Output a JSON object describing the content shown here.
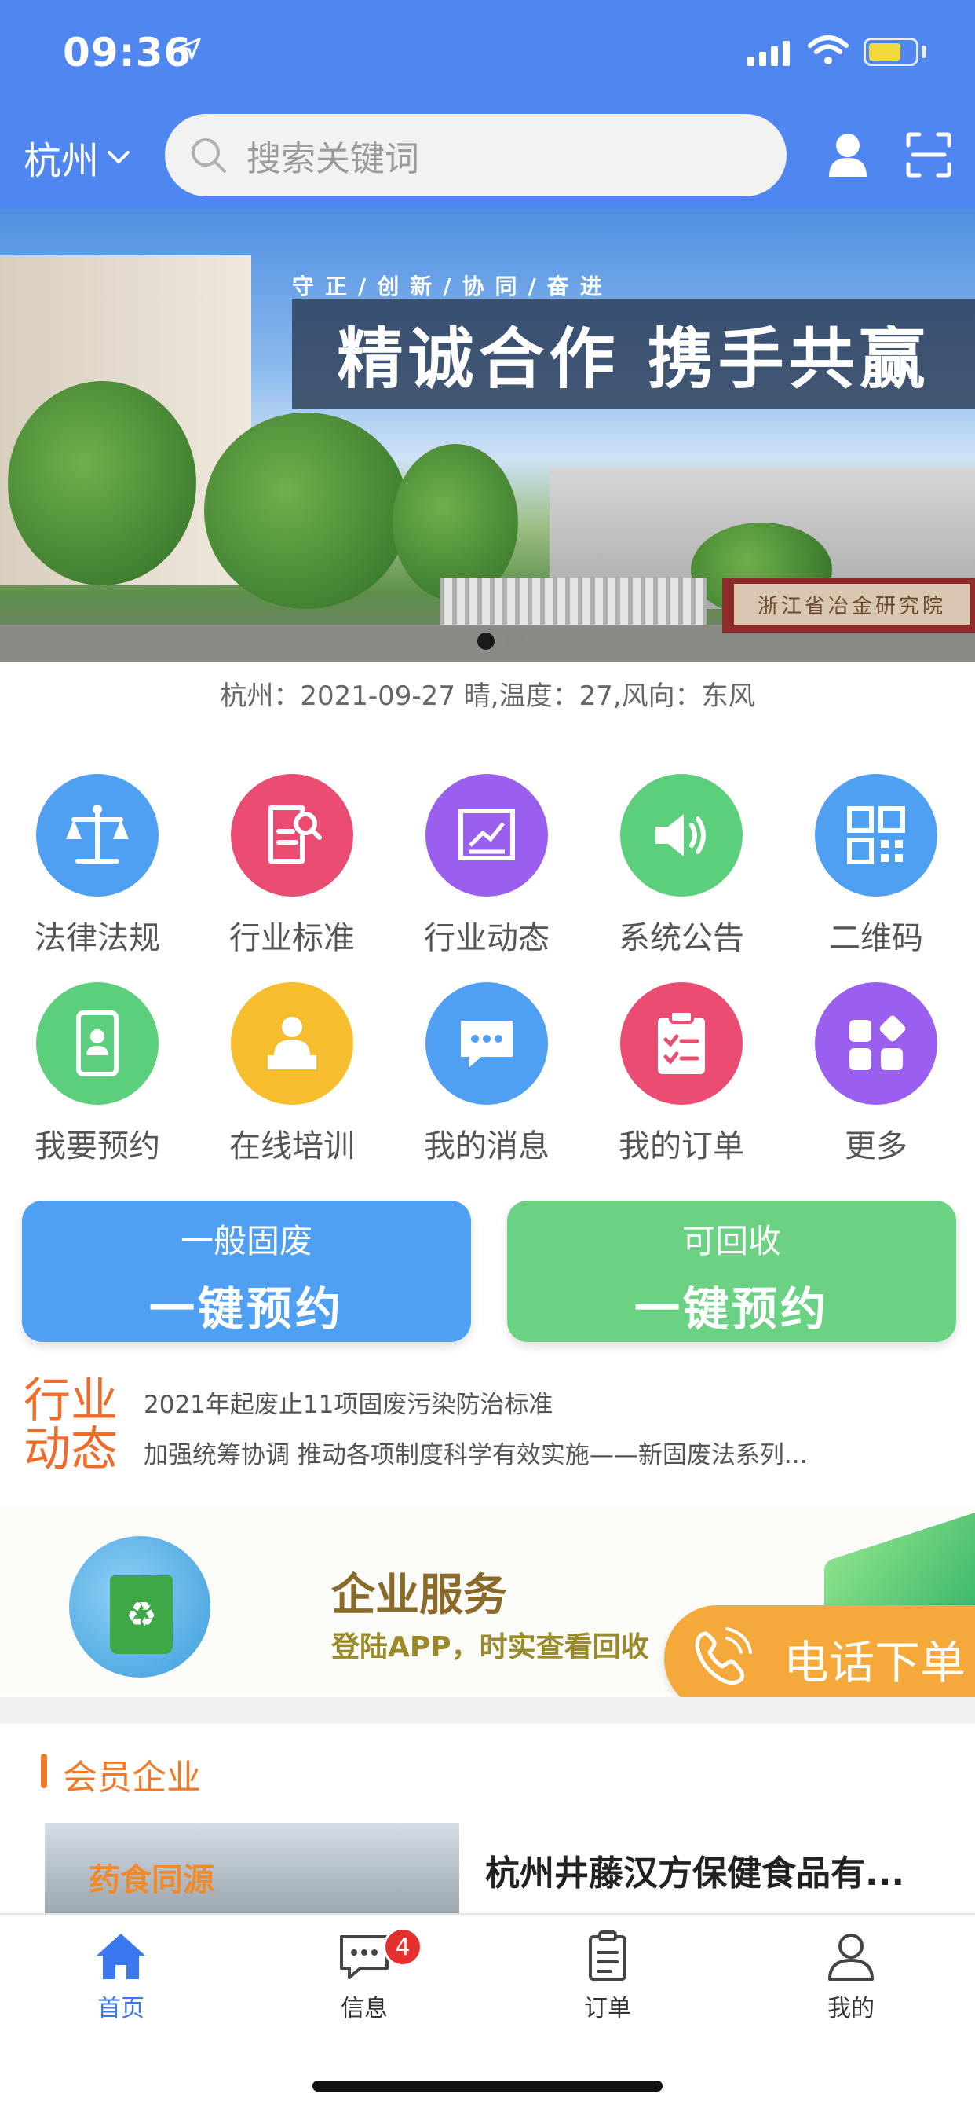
{
  "status": {
    "time": "09:36"
  },
  "header": {
    "city": "杭州",
    "search_placeholder": "搜索关键词"
  },
  "banner": {
    "slogan_small": "守正/创新/协同/奋进",
    "slogan_main": "精诚合作 携手共赢",
    "sign_text": "浙江省冶金研究院"
  },
  "weather": "杭州：2021-09-27   晴,温度：27,风向：东风",
  "grid": [
    {
      "label": "法律法规",
      "icon": "scale-icon",
      "color": "#4f9ff2"
    },
    {
      "label": "行业标准",
      "icon": "document-search-icon",
      "color": "#ea4c72"
    },
    {
      "label": "行业动态",
      "icon": "chart-board-icon",
      "color": "#9b5ff0"
    },
    {
      "label": "系统公告",
      "icon": "speaker-icon",
      "color": "#5ccf7c"
    },
    {
      "label": "二维码",
      "icon": "qrcode-icon",
      "color": "#4f9ff2"
    },
    {
      "label": "我要预约",
      "icon": "phone-contact-icon",
      "color": "#5ccf7c"
    },
    {
      "label": "在线培训",
      "icon": "trainer-icon",
      "color": "#f6bd2e"
    },
    {
      "label": "我的消息",
      "icon": "chat-icon",
      "color": "#4f9ff2"
    },
    {
      "label": "我的订单",
      "icon": "clipboard-check-icon",
      "color": "#ea4c72"
    },
    {
      "label": "更多",
      "icon": "apps-icon",
      "color": "#9b5ff0"
    }
  ],
  "booking": {
    "left": {
      "sub": "一般固废",
      "main": "一键预约",
      "color": "#4f9ff2"
    },
    "right": {
      "sub": "可回收",
      "main": "一键预约",
      "color": "#6bd283"
    }
  },
  "news": {
    "logo_line1": "行业",
    "logo_line2": "动态",
    "items": [
      "2021年起废止11项固废污染防治标准",
      "加强统筹协调 推动各项制度科学有效实施——新固废法系列..."
    ]
  },
  "enterprise": {
    "title": "企业服务",
    "subtitle": "登陆APP，时实查看回收"
  },
  "phone_order": {
    "label": "电话下单"
  },
  "members": {
    "title": "会员企业",
    "company_image_text": "药食同源",
    "company_name": "杭州井藤汉方保健食品有..."
  },
  "tabbar": [
    {
      "label": "首页",
      "icon": "home-icon",
      "active": true
    },
    {
      "label": "信息",
      "icon": "message-icon",
      "badge": "4"
    },
    {
      "label": "订单",
      "icon": "order-list-icon"
    },
    {
      "label": "我的",
      "icon": "person-icon"
    }
  ]
}
